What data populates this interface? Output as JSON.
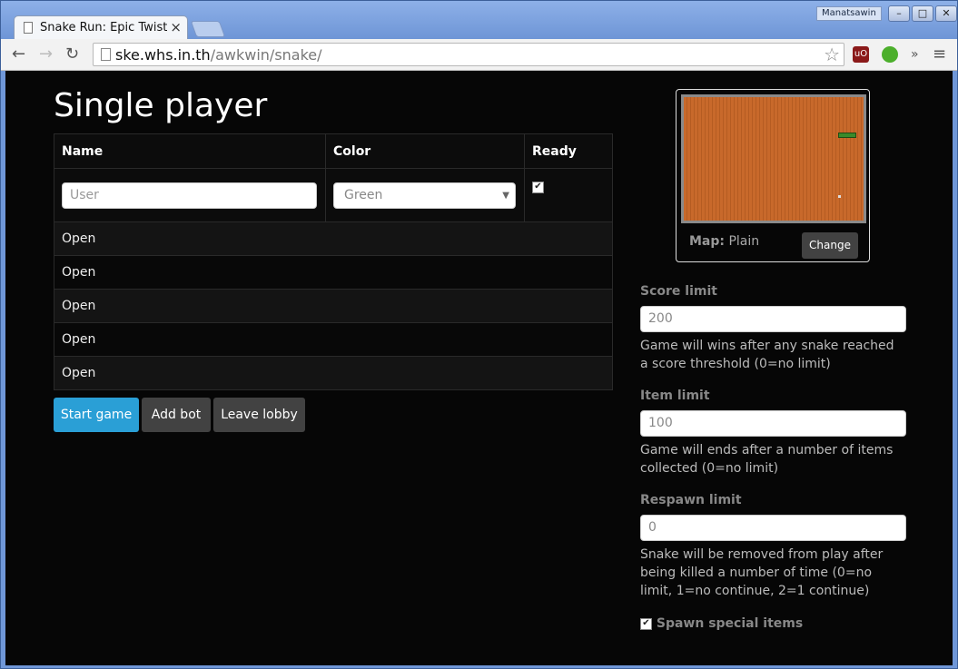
{
  "browser": {
    "tab_title": "Snake Run: Epic Twist",
    "tab_close": "×",
    "user_badge": "Manatsawin",
    "url_host": "ske.whs.in.th",
    "url_path": "/awkwin/snake/",
    "window_buttons": [
      "–",
      "□",
      "✕"
    ],
    "nav_icons": [
      "←",
      "→",
      "↻"
    ],
    "bookmark_star": "☆",
    "extension_icons": [
      "ublock-icon",
      "evernote-icon"
    ],
    "menu_overflow": "»",
    "menu_icon": "≡"
  },
  "page": {
    "heading": "Single player",
    "table": {
      "headers": [
        "Name",
        "Color",
        "Ready"
      ],
      "player": {
        "name_placeholder": "User",
        "color_value": "Green",
        "ready_checked": true
      },
      "open_slots": [
        "Open",
        "Open",
        "Open",
        "Open",
        "Open"
      ]
    },
    "buttons": {
      "start": "Start game",
      "add_bot": "Add bot",
      "leave": "Leave lobby"
    },
    "map": {
      "label": "Map:",
      "value": "Plain",
      "change_button": "Change"
    },
    "settings": {
      "score": {
        "label": "Score limit",
        "placeholder": "200",
        "help": "Game will wins after any snake reached a score threshold (0=no limit)"
      },
      "item": {
        "label": "Item limit",
        "placeholder": "100",
        "help": "Game will ends after a number of items collected (0=no limit)"
      },
      "respawn": {
        "label": "Respawn limit",
        "placeholder": "0",
        "help": "Snake will be removed from play after being killed a number of time (0=no limit, 1=no continue, 2=1 continue)"
      },
      "special": {
        "label": "Spawn special items",
        "checked": true
      }
    }
  },
  "colors": {
    "page_bg": "#060606",
    "primary_button": "#2a9fd6",
    "default_button": "#424242",
    "map_floor": "#c8692b"
  }
}
